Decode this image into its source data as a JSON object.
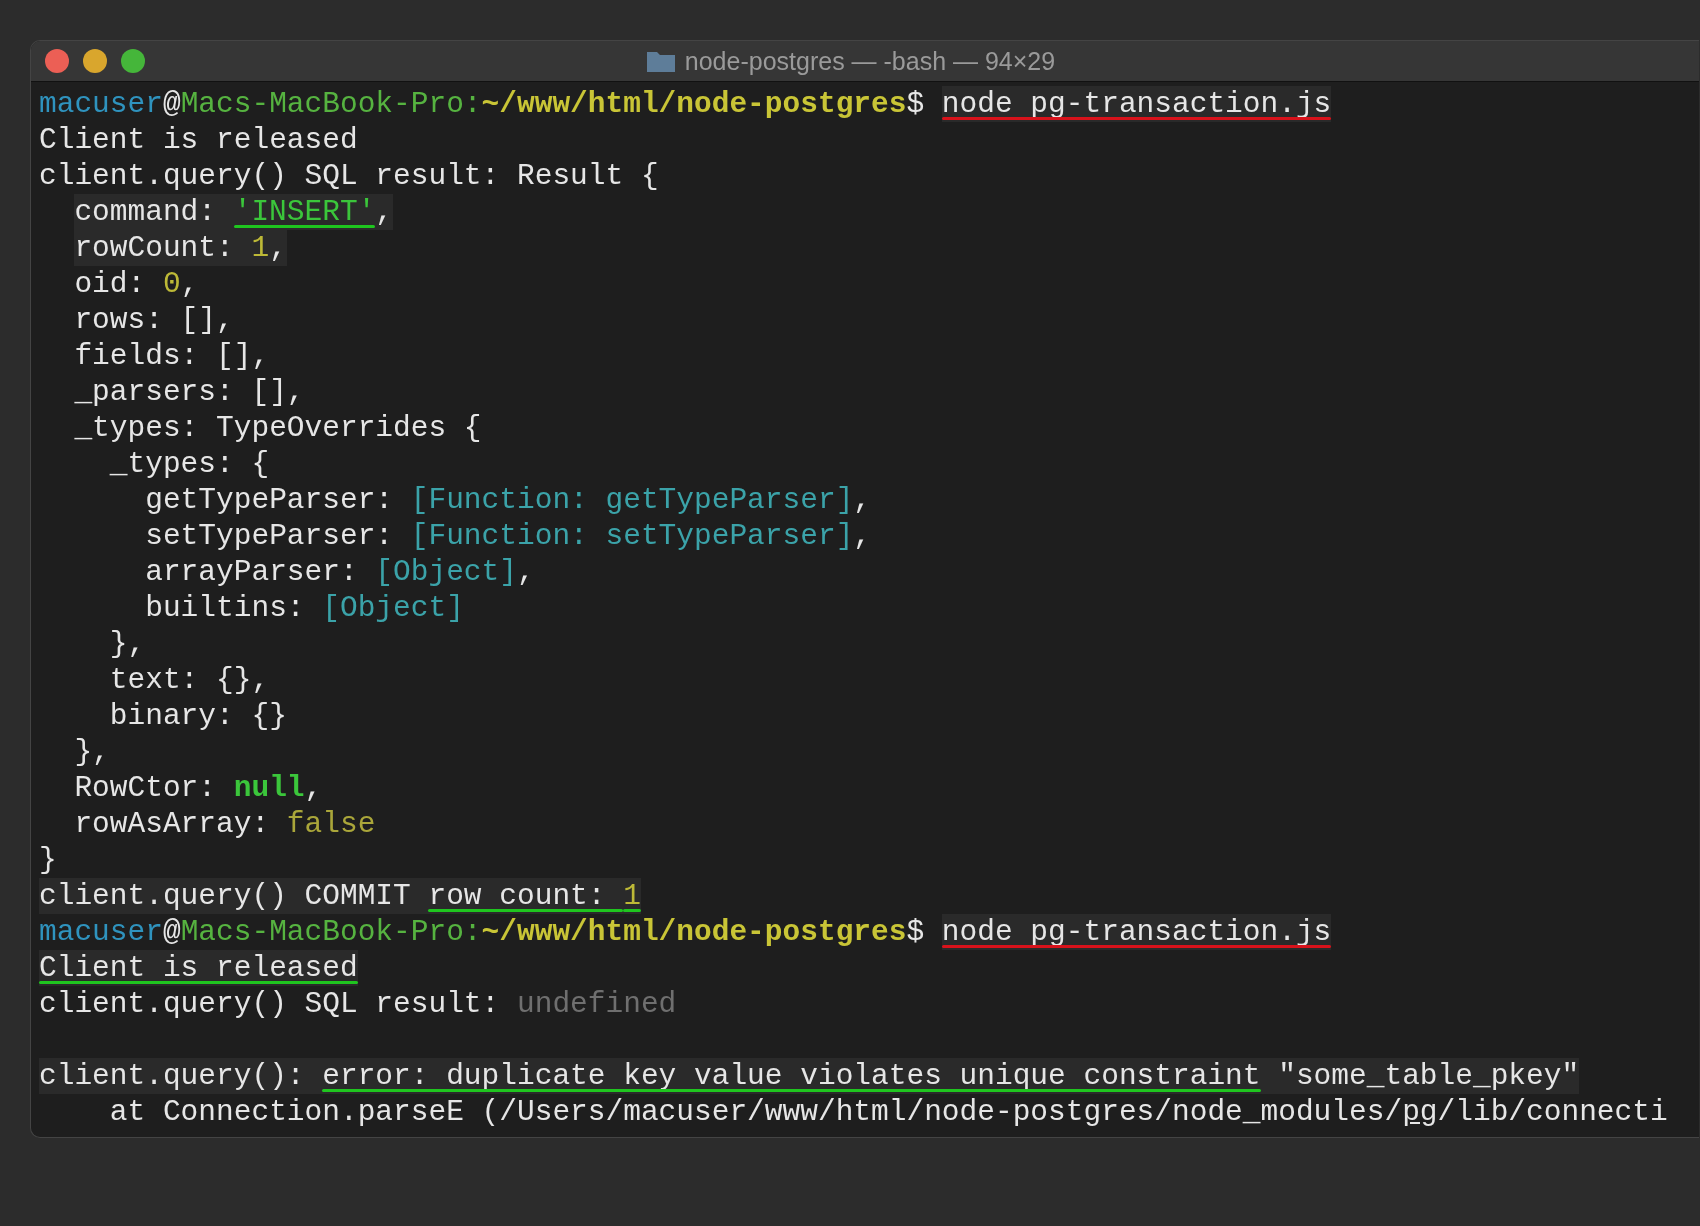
{
  "window": {
    "title": "node-postgres — -bash — 94×29"
  },
  "lines": [
    {
      "kind": "text",
      "segments": [
        {
          "text": "macuser",
          "kind": "user"
        },
        {
          "text": "@",
          "kind": "plain"
        },
        {
          "text": "Macs-MacBook-Pro:",
          "kind": "host"
        },
        {
          "text": "~/www/html/node-postgres",
          "kind": "path"
        },
        {
          "text": "$ ",
          "kind": "plain"
        },
        {
          "text": "node pg-transaction.js",
          "kind": "plain",
          "highlight": true,
          "underline": {
            "color": "#d8121b"
          }
        }
      ]
    },
    {
      "kind": "text",
      "segments": [
        {
          "text": "Client is released",
          "kind": "plain"
        }
      ]
    },
    {
      "kind": "text",
      "segments": [
        {
          "text": "client.query() SQL result: Result {",
          "kind": "plain"
        }
      ]
    },
    {
      "kind": "text",
      "indented": true,
      "segments": [
        {
          "text": "command: ",
          "kind": "plain",
          "highlight": true
        },
        {
          "text": "'INSERT'",
          "kind": "string",
          "highlight": true,
          "underline": {
            "color": "#1fc51f"
          }
        },
        {
          "text": ",",
          "kind": "plain",
          "highlight": true
        }
      ]
    },
    {
      "kind": "text",
      "indented": true,
      "segments": [
        {
          "text": "rowCount: ",
          "kind": "plain",
          "highlight": true
        },
        {
          "text": "1",
          "kind": "number",
          "highlight": true
        },
        {
          "text": ",",
          "kind": "plain",
          "highlight": true
        }
      ]
    },
    {
      "kind": "text",
      "segments": [
        {
          "text": "  oid: ",
          "kind": "plain"
        },
        {
          "text": "0",
          "kind": "number"
        },
        {
          "text": ",",
          "kind": "plain"
        }
      ]
    },
    {
      "kind": "text",
      "segments": [
        {
          "text": "  rows: [],",
          "kind": "plain"
        }
      ]
    },
    {
      "kind": "text",
      "segments": [
        {
          "text": "  fields: [],",
          "kind": "plain"
        }
      ]
    },
    {
      "kind": "text",
      "segments": [
        {
          "text": "  _parsers: [],",
          "kind": "plain"
        }
      ]
    },
    {
      "kind": "text",
      "segments": [
        {
          "text": "  _types: TypeOverrides {",
          "kind": "plain"
        }
      ]
    },
    {
      "kind": "text",
      "segments": [
        {
          "text": "    _types: {",
          "kind": "plain"
        }
      ]
    },
    {
      "kind": "text",
      "segments": [
        {
          "text": "      getTypeParser: ",
          "kind": "plain"
        },
        {
          "text": "[Function: getTypeParser]",
          "kind": "function"
        },
        {
          "text": ",",
          "kind": "plain"
        }
      ]
    },
    {
      "kind": "text",
      "segments": [
        {
          "text": "      setTypeParser: ",
          "kind": "plain"
        },
        {
          "text": "[Function: setTypeParser]",
          "kind": "function"
        },
        {
          "text": ",",
          "kind": "plain"
        }
      ]
    },
    {
      "kind": "text",
      "segments": [
        {
          "text": "      arrayParser: ",
          "kind": "plain"
        },
        {
          "text": "[Object]",
          "kind": "function"
        },
        {
          "text": ",",
          "kind": "plain"
        }
      ]
    },
    {
      "kind": "text",
      "segments": [
        {
          "text": "      builtins: ",
          "kind": "plain"
        },
        {
          "text": "[Object]",
          "kind": "function"
        }
      ]
    },
    {
      "kind": "text",
      "segments": [
        {
          "text": "    },",
          "kind": "plain"
        }
      ]
    },
    {
      "kind": "text",
      "segments": [
        {
          "text": "    text: {},",
          "kind": "plain"
        }
      ]
    },
    {
      "kind": "text",
      "segments": [
        {
          "text": "    binary: {}",
          "kind": "plain"
        }
      ]
    },
    {
      "kind": "text",
      "segments": [
        {
          "text": "  },",
          "kind": "plain"
        }
      ]
    },
    {
      "kind": "text",
      "segments": [
        {
          "text": "  RowCtor: ",
          "kind": "plain"
        },
        {
          "text": "null",
          "kind": "null"
        },
        {
          "text": ",",
          "kind": "plain"
        }
      ]
    },
    {
      "kind": "text",
      "segments": [
        {
          "text": "  rowAsArray: ",
          "kind": "plain"
        },
        {
          "text": "false",
          "kind": "bool"
        }
      ]
    },
    {
      "kind": "text",
      "segments": [
        {
          "text": "}",
          "kind": "plain"
        }
      ]
    },
    {
      "kind": "text",
      "segments": [
        {
          "text": "client.query() COMMIT ",
          "kind": "plain",
          "highlight": true
        },
        {
          "text": "row count: ",
          "kind": "plain",
          "highlight": true,
          "underline": {
            "color": "#1fc51f"
          }
        },
        {
          "text": "1",
          "kind": "number",
          "highlight": true,
          "underline": {
            "color": "#1fc51f"
          }
        }
      ]
    },
    {
      "kind": "text",
      "segments": [
        {
          "text": "macuser",
          "kind": "user"
        },
        {
          "text": "@",
          "kind": "plain"
        },
        {
          "text": "Macs-MacBook-Pro:",
          "kind": "host"
        },
        {
          "text": "~/www/html/node-postgres",
          "kind": "path"
        },
        {
          "text": "$ ",
          "kind": "plain"
        },
        {
          "text": "node pg-transaction.js",
          "kind": "plain",
          "highlight": true,
          "underline": {
            "color": "#d8121b"
          }
        }
      ]
    },
    {
      "kind": "text",
      "segments": [
        {
          "text": "Client is released",
          "kind": "plain",
          "highlight": true,
          "underline": {
            "color": "#1fc51f"
          }
        }
      ]
    },
    {
      "kind": "text",
      "segments": [
        {
          "text": "client.query() SQL result: ",
          "kind": "plain"
        },
        {
          "text": "undefined",
          "kind": "dim"
        }
      ]
    },
    {
      "kind": "blank"
    },
    {
      "kind": "text",
      "segments": [
        {
          "text": "client.query(): ",
          "kind": "plain",
          "highlight": true
        },
        {
          "text": "error: duplicate key value violates unique constraint",
          "kind": "plain",
          "highlight": true,
          "underline": {
            "color": "#1fc51f"
          }
        },
        {
          "text": " \"some_table_pkey\"",
          "kind": "plain",
          "highlight": true
        }
      ]
    },
    {
      "kind": "text",
      "segments": [
        {
          "text": "    at Connection.parseE (/Users/macuser/www/html/node-postgres/node_modules/",
          "kind": "plain"
        },
        {
          "text": "pg",
          "kind": "link"
        },
        {
          "text": "/lib/connecti",
          "kind": "plain"
        }
      ]
    }
  ]
}
